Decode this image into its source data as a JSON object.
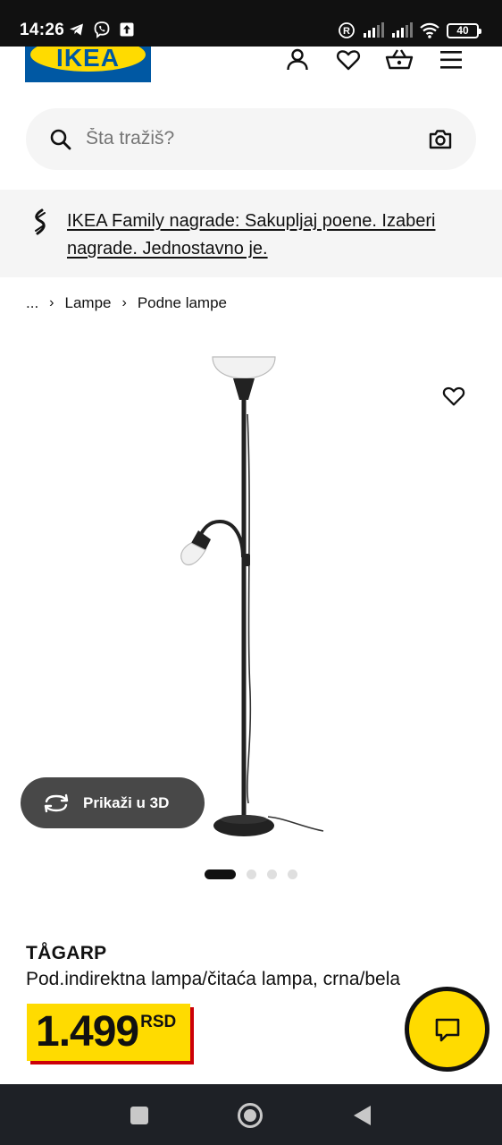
{
  "status_bar": {
    "time": "14:26",
    "battery": "40",
    "icons_left": [
      "telegram-icon",
      "viber-icon",
      "upload-icon"
    ],
    "icons_right": [
      "registered-icon",
      "signal-icon",
      "signal-icon",
      "wifi-icon",
      "battery-icon"
    ]
  },
  "header": {
    "logo_text": "IKEA",
    "icons": [
      "user-icon",
      "heart-icon",
      "cart-icon",
      "menu-icon"
    ]
  },
  "search": {
    "placeholder": "Šta tražiš?"
  },
  "promo": {
    "text": "IKEA Family nagrade: Sakupljaj poene. Izaberi nagrade. Jednostavno je."
  },
  "breadcrumb": {
    "items": [
      "...",
      "Lampe",
      "Podne lampe"
    ]
  },
  "media": {
    "view_3d_label": "Prikaži u 3D",
    "image_count": 4,
    "active_image": 1
  },
  "product": {
    "name": "TÅGARP",
    "description": "Pod.indirektna lampa/čitaća lampa, crna/bela",
    "price": "1.499",
    "currency": "RSD"
  },
  "colors": {
    "ikea_blue": "#0058a3",
    "ikea_yellow": "#ffdb00",
    "price_shadow_red": "#cc0008",
    "button_dark": "#484848"
  }
}
